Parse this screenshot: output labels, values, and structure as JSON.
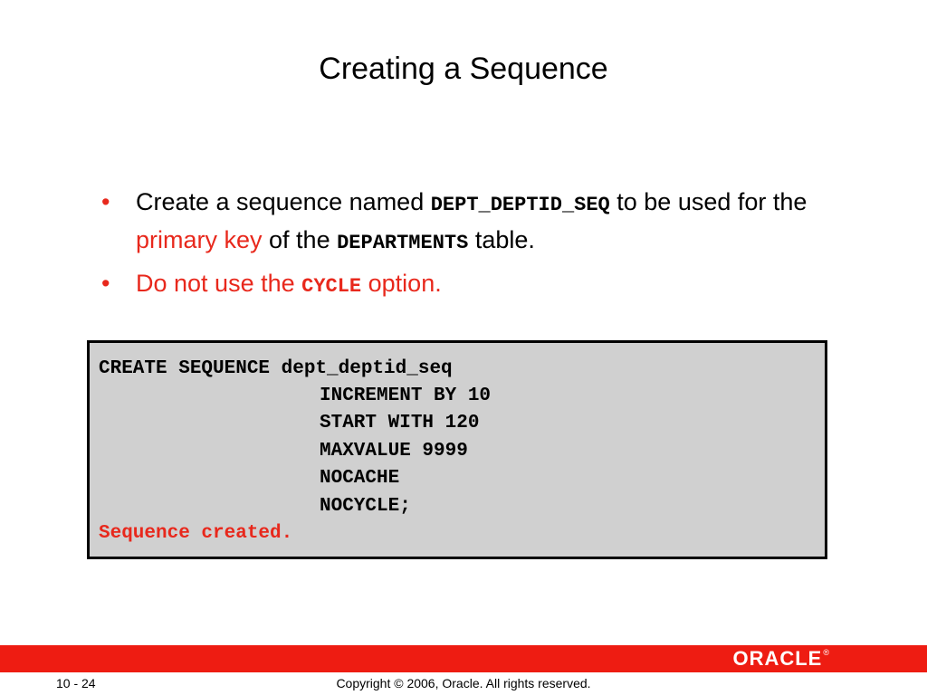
{
  "title": "Creating a Sequence",
  "bullets": {
    "b1": {
      "mark": "•",
      "t1": "Create a sequence named ",
      "code1": "DEPT_DEPTID_SEQ",
      "t2": " to be used for the ",
      "highlight": "primary key",
      "t3": " of the ",
      "code2": "DEPARTMENTS",
      "t4": " table."
    },
    "b2": {
      "mark": "•",
      "t1": "Do not use the ",
      "code": "CYCLE",
      "t2": " option."
    }
  },
  "code": {
    "line1": "CREATE SEQUENCE dept_deptid_seq",
    "line2": "INCREMENT BY 10",
    "line3": "START WITH 120",
    "line4": "MAXVALUE 9999",
    "line5": "NOCACHE",
    "line6": "NOCYCLE;",
    "result": "Sequence created."
  },
  "footer": {
    "logo": "ORACLE",
    "logo_reg": "®",
    "slide_number": "10 - 24",
    "copyright": "Copyright © 2006, Oracle. All rights reserved."
  },
  "colors": {
    "accent_red": "#e8281c",
    "footer_bar": "#ee1c12",
    "code_background": "#d0d0d0"
  }
}
